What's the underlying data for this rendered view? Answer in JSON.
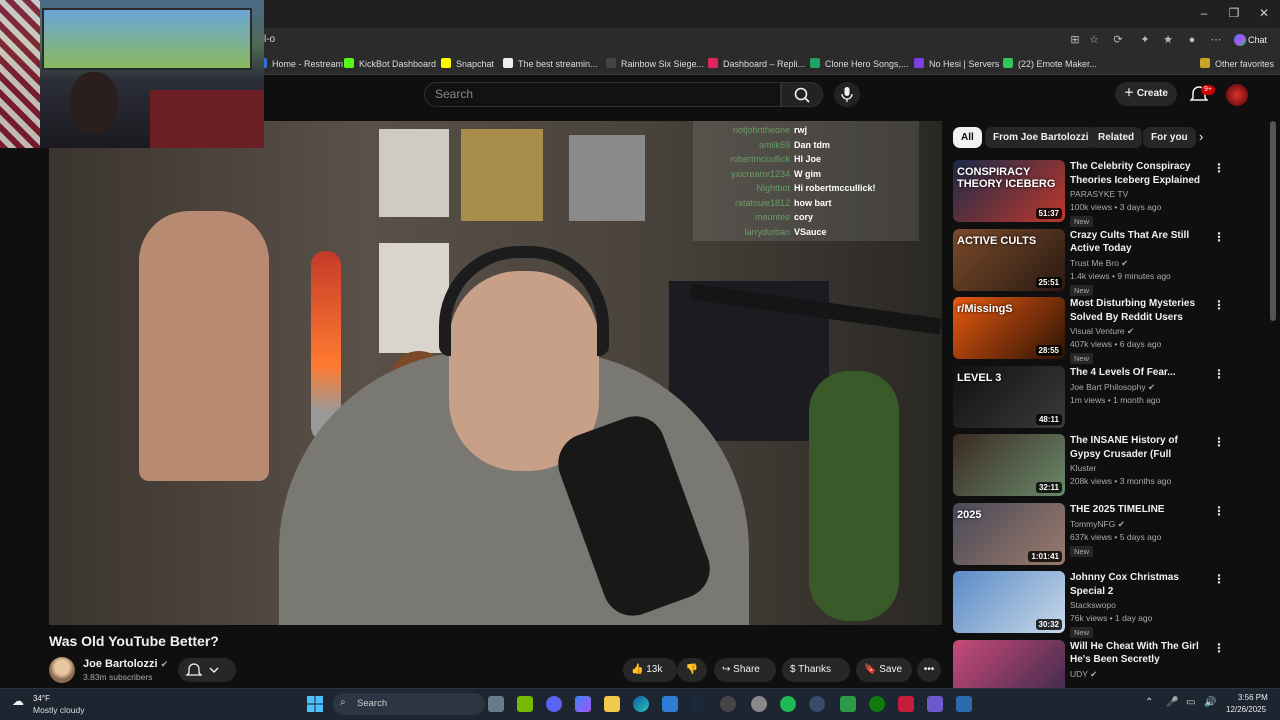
{
  "browser": {
    "url": "l-o",
    "chat_label": "Chat",
    "bookmarks": [
      {
        "label": "Home - Restream",
        "color": "#3a6fd8"
      },
      {
        "label": "KickBot Dashboard",
        "color": "#53fc18"
      },
      {
        "label": "Snapchat",
        "color": "#fffc00"
      },
      {
        "label": "The best streamin...",
        "color": "#eeeeee"
      },
      {
        "label": "Rainbow Six Siege...",
        "color": "#444444"
      },
      {
        "label": "Dashboard – Repli...",
        "color": "#e0245e"
      },
      {
        "label": "Clone Hero Songs,...",
        "color": "#1fa463"
      },
      {
        "label": "No Hesi | Servers",
        "color": "#7b3fe4"
      },
      {
        "label": "(22) Emote Maker...",
        "color": "#34c759"
      }
    ],
    "other_favorites": "Other favorites"
  },
  "youtube": {
    "search_placeholder": "Search",
    "create_label": "Create",
    "notif_badge": "9+"
  },
  "stream_chat": [
    {
      "user": "notjohntheone",
      "msg": "rwj"
    },
    {
      "user": "amilk69",
      "msg": "Dan tdm"
    },
    {
      "user": "robertmccullick",
      "msg": "HI Joe"
    },
    {
      "user": "yxlcreamr1234",
      "msg": "W gim"
    },
    {
      "user": "Nightbot",
      "msg": "Hi robertmccullick!"
    },
    {
      "user": "ratatouie1812",
      "msg": "how bart"
    },
    {
      "user": "meuntee",
      "msg": "cory"
    },
    {
      "user": "larrydurban",
      "msg": "VSauce"
    }
  ],
  "video": {
    "title": "Was Old YouTube Better?",
    "channel": "Joe Bartolozzi",
    "subscribers": "3.83m subscribers",
    "likes": "13k",
    "share": "Share",
    "thanks": "Thanks",
    "save": "Save"
  },
  "chips": [
    {
      "label": "All",
      "active": true
    },
    {
      "label": "From Joe Bartolozzi",
      "active": false
    },
    {
      "label": "Related",
      "active": false
    },
    {
      "label": "For you",
      "active": false
    }
  ],
  "recommendations": [
    {
      "title": "The Celebrity Conspiracy Theories Iceberg Explained - ...",
      "channel": "PARASYKE TV",
      "verified": false,
      "meta": "100k views • 3 days ago",
      "badge": "New",
      "duration": "51:37",
      "thumb_text": "CONSPIRACY THEORY ICEBERG",
      "colors": [
        "#1b2a4a",
        "#c0392b"
      ]
    },
    {
      "title": "Crazy Cults That Are Still Active Today",
      "channel": "Trust Me Bro",
      "verified": true,
      "meta": "1.4k views • 9 minutes ago",
      "badge": "New",
      "duration": "25:51",
      "thumb_text": "ACTIVE CULTS",
      "colors": [
        "#7a4a2a",
        "#2a1a12"
      ]
    },
    {
      "title": "Most Disturbing Mysteries Solved By Reddit Users",
      "channel": "Visual Venture",
      "verified": true,
      "meta": "407k views • 6 days ago",
      "badge": "New",
      "duration": "28:55",
      "thumb_text": "r/MissingS",
      "colors": [
        "#e85a10",
        "#2a1205"
      ]
    },
    {
      "title": "The 4 Levels Of Fear...",
      "channel": "Joe Bart Philosophy",
      "verified": true,
      "meta": "1m views • 1 month ago",
      "badge": "",
      "duration": "48:11",
      "thumb_text": "LEVEL 3",
      "colors": [
        "#111111",
        "#3a3a3a"
      ]
    },
    {
      "title": "The INSANE History of Gypsy Crusader (Full Documentary)",
      "channel": "Kluster",
      "verified": false,
      "meta": "208k views • 3 months ago",
      "badge": "",
      "duration": "32:11",
      "thumb_text": "",
      "colors": [
        "#3a2a22",
        "#6a8a6a"
      ]
    },
    {
      "title": "THE 2025 TIMELINE",
      "channel": "TommyNFG",
      "verified": true,
      "meta": "637k views • 5 days ago",
      "badge": "New",
      "duration": "1:01:41",
      "thumb_text": "2025",
      "colors": [
        "#4a4a5a",
        "#9a7a6a"
      ]
    },
    {
      "title": "Johnny Cox Christmas Special 2",
      "channel": "Stackswopo",
      "verified": false,
      "meta": "76k views • 1 day ago",
      "badge": "New",
      "duration": "30:32",
      "thumb_text": "",
      "colors": [
        "#5a8ac8",
        "#c8d8e8"
      ]
    },
    {
      "title": "Will He Cheat With The Girl He's Been Secretly Messaging? | U...",
      "channel": "UDY",
      "verified": true,
      "meta": "",
      "badge": "",
      "duration": "",
      "thumb_text": "",
      "colors": [
        "#c84a7a",
        "#3a2a4a"
      ]
    }
  ],
  "taskbar": {
    "weather_temp": "34°F",
    "weather_desc": "Mostly cloudy",
    "search_label": "Search",
    "time": "3:56 PM",
    "date": "12/26/2025"
  }
}
